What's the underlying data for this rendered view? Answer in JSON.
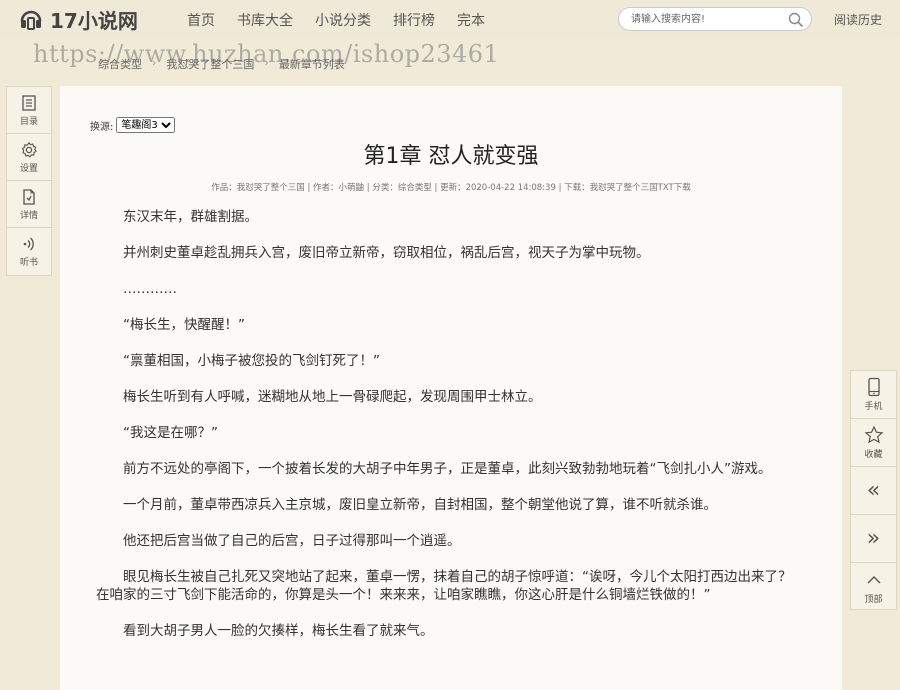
{
  "header": {
    "logo_text": "17小说网",
    "nav": [
      "首页",
      "书库大全",
      "小说分类",
      "排行榜",
      "完本"
    ],
    "search_placeholder": "请输入搜索内容!",
    "history_label": "阅读历史"
  },
  "watermark": "https://www.huzhan.com/ishop23461",
  "breadcrumb": [
    "综合类型",
    "我怼哭了整个三国",
    "最新章节列表"
  ],
  "left_toolbar": [
    {
      "label": "目录",
      "icon": "catalog-icon"
    },
    {
      "label": "设置",
      "icon": "gear-icon"
    },
    {
      "label": "详情",
      "icon": "details-icon"
    },
    {
      "label": "听书",
      "icon": "audio-icon"
    }
  ],
  "content": {
    "source_label": "换源:",
    "source_options": [
      "笔趣阁3"
    ],
    "chapter_title": "第1章 怼人就变强",
    "meta": "作品：我怼哭了整个三国  |  作者：小萌鼬  |  分类：综合类型  |  更新：2020-04-22 14:08:39  |  下载：我怼哭了整个三国TXT下载",
    "paragraphs": [
      "东汉末年，群雄割据。",
      "并州刺史董卓趁乱拥兵入宫，废旧帝立新帝，窃取相位，祸乱后宫，视天子为掌中玩物。",
      "…………",
      "“梅长生，快醒醒！”",
      "“禀董相国，小梅子被您投的飞剑钉死了！”",
      "梅长生听到有人呼喊，迷糊地从地上一骨碌爬起，发现周围甲士林立。",
      "“我这是在哪？”",
      "前方不远处的亭阁下，一个披着长发的大胡子中年男子，正是董卓，此刻兴致勃勃地玩着“飞剑扎小人”游戏。",
      "一个月前，董卓带西凉兵入主京城，废旧皇立新帝，自封相国，整个朝堂他说了算，谁不听就杀谁。",
      "他还把后宫当做了自己的后宫，日子过得那叫一个逍遥。",
      "眼见梅长生被自己扎死又突地站了起来，董卓一愣，抹着自己的胡子惊呼道：“诶呀，今儿个太阳打西边出来了？在咱家的三寸飞剑下能活命的，你算是头一个！来来来，让咱家瞧瞧，你这心肝是什么铜墙烂铁做的！”",
      "看到大胡子男人一脸的欠揍样，梅长生看了就来气。"
    ]
  },
  "right_toolbar": {
    "mobile_label": "手机",
    "favorite_label": "收藏",
    "prev_glyph": "«",
    "next_glyph": "»",
    "top_label": "顶部"
  }
}
